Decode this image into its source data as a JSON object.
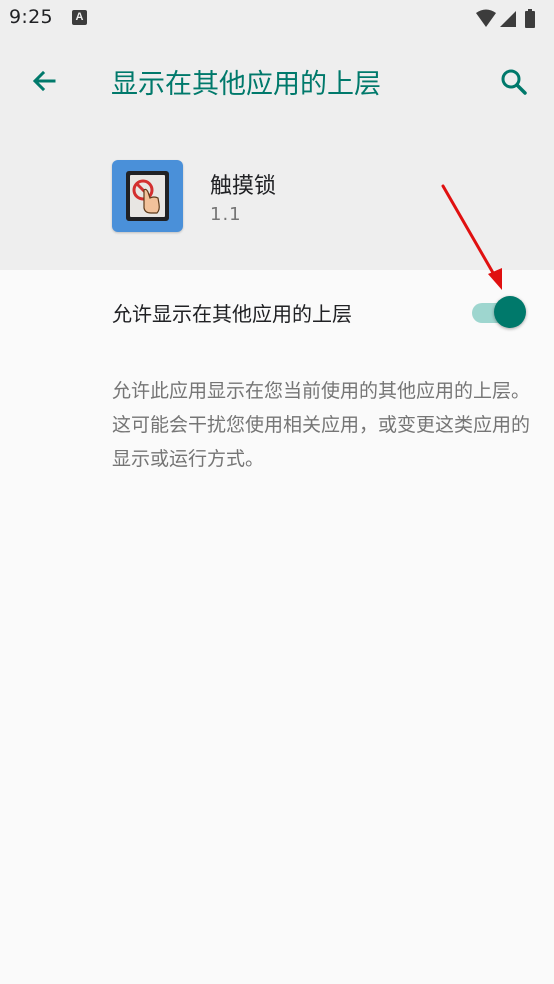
{
  "status_bar": {
    "time": "9:25",
    "notification_icon": "a-icon",
    "notification_letter": "A",
    "wifi_icon": "wifi-icon",
    "signal_icon": "cell-signal-icon",
    "battery_icon": "battery-icon"
  },
  "app_bar": {
    "back_icon": "arrow-back-icon",
    "title": "显示在其他应用的上层",
    "search_icon": "search-icon"
  },
  "app_info": {
    "icon": "touch-lock-app-icon",
    "name": "触摸锁",
    "version": "1.1"
  },
  "permission": {
    "label": "允许显示在其他应用的上层",
    "enabled": true,
    "description": "允许此应用显示在您当前使用的其他应用的上层。这可能会干扰您使用相关应用，或变更这类应用的显示或运行方式。"
  },
  "annotation": {
    "arrow_icon": "red-arrow-icon"
  },
  "colors": {
    "accent": "#00796b",
    "switch_track": "#9ed6cf",
    "header_background": "#eeeeee",
    "page_background": "#fafafa",
    "annotation_arrow": "#e01010"
  }
}
